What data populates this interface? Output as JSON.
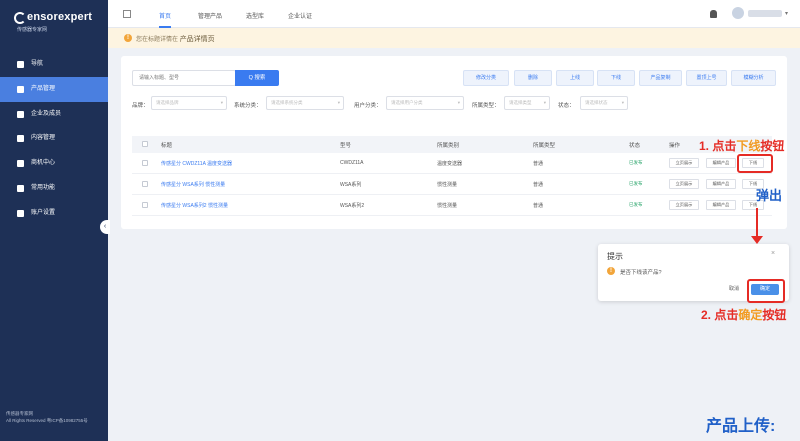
{
  "sidebar": {
    "brand": "ensorexpert",
    "brand_sub": "传感器专家网",
    "items": [
      {
        "label": "导航",
        "active": false
      },
      {
        "label": "产品管理",
        "active": true
      },
      {
        "label": "企业及成员",
        "active": false
      },
      {
        "label": "内容管理",
        "active": false
      },
      {
        "label": "商机中心",
        "active": false
      },
      {
        "label": "常用功能",
        "active": false
      },
      {
        "label": "账户设置",
        "active": false
      }
    ],
    "footer_line1": "传感器专家网",
    "footer_line2": "All Rights Reserved 粤ICP备10982755号",
    "collapse": "‹"
  },
  "topbar": {
    "tabs": [
      {
        "label": "首页",
        "active": true
      },
      {
        "label": "管理产品",
        "active": false
      },
      {
        "label": "选型库",
        "active": false
      },
      {
        "label": "企业认证",
        "active": false
      }
    ],
    "user_caret": "▾"
  },
  "notice": {
    "icon": "!",
    "text": "您在标题详情在",
    "strong": "产品详情页"
  },
  "toolbar": {
    "search_placeholder": "请输入标题、型号",
    "search_button": "Q 搜索",
    "actions": [
      "修改分类",
      "删除",
      "上线",
      "下线",
      "产品复制",
      "置顶上号",
      "模糊分析"
    ]
  },
  "filters": [
    {
      "label": "品牌：",
      "placeholder": "请选择品牌"
    },
    {
      "label": "系统分类：",
      "placeholder": "请选择系统分类"
    },
    {
      "label": "用户分类：",
      "placeholder": "请选择用户分类"
    },
    {
      "label": "所属类型：",
      "placeholder": "请选择类型"
    },
    {
      "label": "状态：",
      "placeholder": "请选择状态"
    }
  ],
  "table": {
    "headers": [
      "标题",
      "型号",
      "所属类别",
      "所属类型",
      "状态",
      "操作"
    ],
    "rows": [
      {
        "title": "传感星分 CWDZ11A 温度变送器",
        "model": "CWDZ11A",
        "category": "温度变送器",
        "type": "普通",
        "status": "已发布"
      },
      {
        "title": "传感星分 WSA系列 惯性测量",
        "model": "WSA系列",
        "category": "惯性测量",
        "type": "普通",
        "status": "已发布"
      },
      {
        "title": "传感星分 WSA系列2 惯性测量",
        "model": "WSA系列2",
        "category": "惯性测量",
        "type": "普通",
        "status": "已发布"
      }
    ],
    "op_labels": [
      "立页展示",
      "编辑产品",
      "下线"
    ]
  },
  "dialog": {
    "title": "提示",
    "close": "×",
    "icon": "!",
    "message": "是否下线该产品?",
    "cancel": "取消",
    "confirm": "确定"
  },
  "annotations": {
    "step1_prefix": "1. 点击",
    "step1_highlight": "下线",
    "step1_suffix": "按钮",
    "popup": "弹出",
    "step2_prefix": "2. 点击",
    "step2_highlight": "确定",
    "step2_suffix": "按钮",
    "upload": "产品上传:"
  },
  "colors": {
    "sidebar_bg": "#1e3056",
    "accent": "#3a7bf0",
    "annotation_red": "#e52b25",
    "annotation_orange": "#f29b21",
    "annotation_blue": "#2060c8"
  }
}
